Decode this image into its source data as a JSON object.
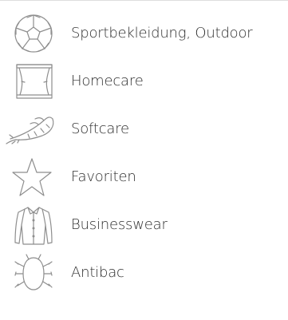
{
  "programs": [
    {
      "label": "Sportbekleidung, Outdoor",
      "icon": "soccer-ball-icon"
    },
    {
      "label": "Homecare",
      "icon": "curtain-window-icon"
    },
    {
      "label": "Softcare",
      "icon": "feather-icon"
    },
    {
      "label": "Favoriten",
      "icon": "star-icon"
    },
    {
      "label": "Businesswear",
      "icon": "shirt-icon"
    },
    {
      "label": "Antibac",
      "icon": "bug-icon"
    }
  ],
  "colors": {
    "icon_stroke": "#8e8e8e",
    "text": "#2f2f2f",
    "divider": "#dedede"
  }
}
